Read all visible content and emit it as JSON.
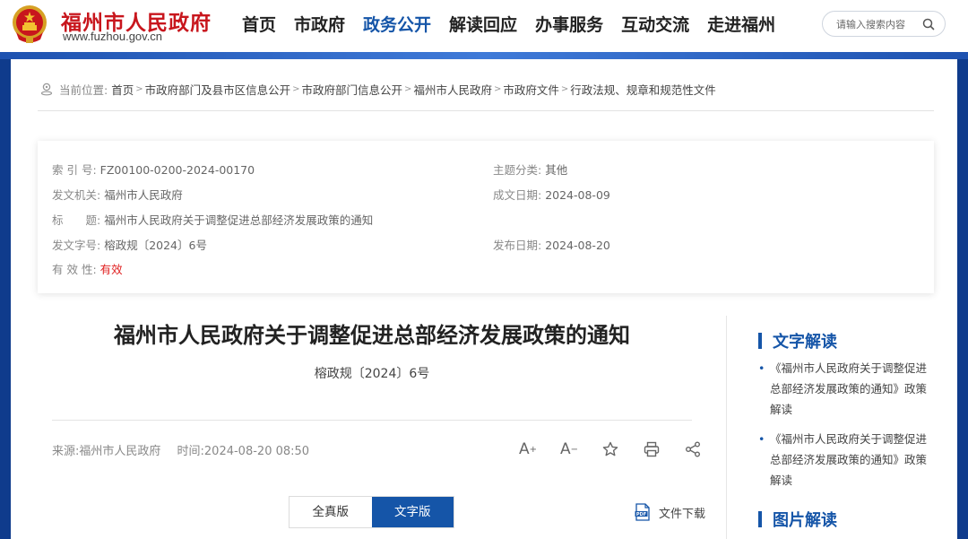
{
  "header": {
    "site_title": "福州市人民政府",
    "site_url": "www.fuzhou.gov.cn",
    "nav": [
      {
        "label": "首页"
      },
      {
        "label": "市政府"
      },
      {
        "label": "政务公开"
      },
      {
        "label": "解读回应"
      },
      {
        "label": "办事服务"
      },
      {
        "label": "互动交流"
      },
      {
        "label": "走进福州"
      }
    ],
    "active_nav": "政务公开",
    "search_placeholder": "请输入搜索内容"
  },
  "breadcrumb": {
    "label": "当前位置:",
    "items": [
      {
        "label": "首页"
      },
      {
        "label": "市政府部门及县市区信息公开"
      },
      {
        "label": "市政府部门信息公开"
      },
      {
        "label": "福州市人民政府"
      },
      {
        "label": "市政府文件"
      },
      {
        "label": "行政法规、规章和规范性文件"
      }
    ]
  },
  "info": {
    "index_label": "索 引 号:",
    "index_value": "FZ00100-0200-2024-00170",
    "topic_label": "主题分类:",
    "topic_value": "其他",
    "issuer_label": "发文机关:",
    "issuer_value": "福州市人民政府",
    "written_label": "成文日期:",
    "written_value": "2024-08-09",
    "title_label": "标　　题:",
    "title_value": "福州市人民政府关于调整促进总部经济发展政策的通知",
    "docno_label": "发文字号:",
    "docno_value": "榕政规〔2024〕6号",
    "published_label": "发布日期:",
    "published_value": "2024-08-20",
    "validity_label": "有 效 性:",
    "validity_value": "有效"
  },
  "article": {
    "title": "福州市人民政府关于调整促进总部经济发展政策的通知",
    "doc_no": "榕政规〔2024〕6号",
    "source": "来源:福州市人民政府",
    "time": "时间:2024-08-20 08:50",
    "font_increase": "A",
    "font_decrease": "A",
    "tab_full": "全真版",
    "tab_text": "文字版",
    "download": "文件下载"
  },
  "sidebar": {
    "text_heading": "文字解读",
    "text_links": [
      {
        "bullet": "•",
        "label": "《福州市人民政府关于调整促进总部经济发展政策的通知》政策解读"
      },
      {
        "bullet": "•",
        "label": "《福州市人民政府关于调整促进总部经济发展政策的通知》政策解读"
      }
    ],
    "image_heading": "图片解读"
  },
  "colors": {
    "brand_red": "#c8161d",
    "brand_blue": "#1555a8",
    "band_blue": "#0f3b8c",
    "valid_red": "#e02020"
  },
  "icons": {
    "emblem": "national-emblem",
    "search": "search-icon",
    "location": "location-icon",
    "star": "star-icon",
    "print": "print-icon",
    "share": "share-icon",
    "pdf": "pdf-icon"
  }
}
